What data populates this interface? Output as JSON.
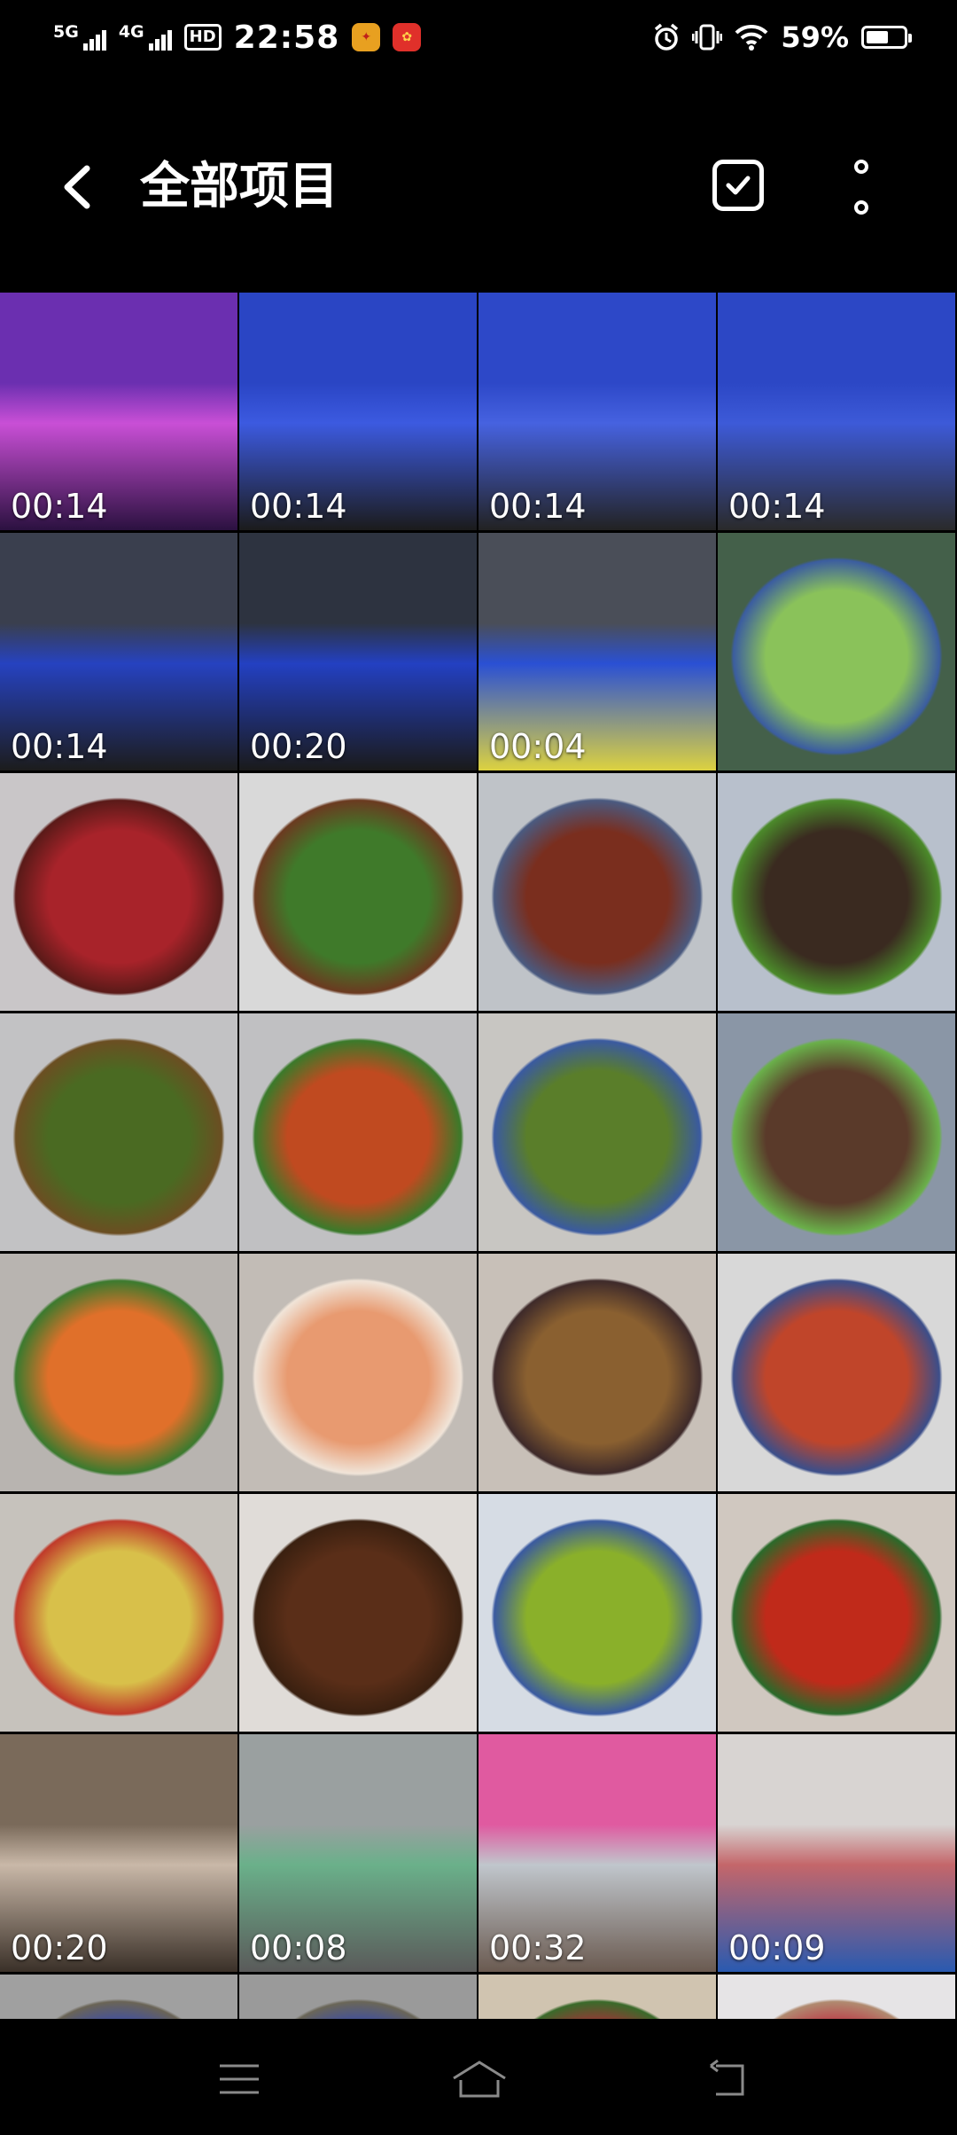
{
  "status_bar": {
    "sig1_label": "5G",
    "sig2_label": "4G",
    "hd_label": "HD",
    "time": "22:58",
    "battery_percent": "59%",
    "battery_level": 0.59
  },
  "header": {
    "title": "全部项目"
  },
  "grid": {
    "columns": 4,
    "items": [
      {
        "duration": "00:14",
        "colors": [
          "#6b2fb0",
          "#c94fd6",
          "#2b1140"
        ]
      },
      {
        "duration": "00:14",
        "colors": [
          "#2a45c4",
          "#3c5ae0",
          "#1b1b1b"
        ]
      },
      {
        "duration": "00:14",
        "colors": [
          "#2d48c8",
          "#4662e0",
          "#222222"
        ]
      },
      {
        "duration": "00:14",
        "colors": [
          "#2c47c5",
          "#3d5ad8",
          "#2a2a2a"
        ]
      },
      {
        "duration": "00:14",
        "colors": [
          "#3a3f4e",
          "#2642c0",
          "#1c1c1c"
        ]
      },
      {
        "duration": "00:20",
        "colors": [
          "#2d3340",
          "#2340c2",
          "#1a1a1a"
        ]
      },
      {
        "duration": "00:04",
        "colors": [
          "#4a4e58",
          "#2a50d4",
          "#dcd240"
        ]
      },
      {
        "duration": "",
        "colors": [
          "#44604a",
          "#8ac25a",
          "#3b5da0"
        ]
      },
      {
        "duration": "",
        "colors": [
          "#c9c6c8",
          "#a8232a",
          "#5a1a18"
        ]
      },
      {
        "duration": "",
        "colors": [
          "#d9d9d9",
          "#3f7a2a",
          "#6b3a20"
        ]
      },
      {
        "duration": "",
        "colors": [
          "#bfc3c8",
          "#7a2e1e",
          "#4a5a80"
        ]
      },
      {
        "duration": "",
        "colors": [
          "#b8c0cc",
          "#3a2a20",
          "#4b8a2a"
        ]
      },
      {
        "duration": "",
        "colors": [
          "#c2c2c4",
          "#4a6a22",
          "#6b4e22"
        ]
      },
      {
        "duration": "",
        "colors": [
          "#c0c0c2",
          "#c04a20",
          "#3a7a2a"
        ]
      },
      {
        "duration": "",
        "colors": [
          "#c8c6c2",
          "#5a7e2a",
          "#3a5aa0"
        ]
      },
      {
        "duration": "",
        "colors": [
          "#8a96a6",
          "#5a3a2a",
          "#6ab04a"
        ]
      },
      {
        "duration": "",
        "colors": [
          "#b8b4b0",
          "#e0702a",
          "#3b7a2e"
        ]
      },
      {
        "duration": "",
        "colors": [
          "#c2bcb6",
          "#e89a70",
          "#f0e4d8"
        ]
      },
      {
        "duration": "",
        "colors": [
          "#c8c0b8",
          "#8a6030",
          "#3e2a2a"
        ]
      },
      {
        "duration": "",
        "colors": [
          "#d8d8d8",
          "#c0452a",
          "#3b4e8a"
        ]
      },
      {
        "duration": "",
        "colors": [
          "#c6c2bc",
          "#d8c04a",
          "#c03a2a"
        ]
      },
      {
        "duration": "",
        "colors": [
          "#e0dcd8",
          "#5a2e18",
          "#3a2010"
        ]
      },
      {
        "duration": "",
        "colors": [
          "#d6dce4",
          "#8ab02a",
          "#3a5aa0"
        ]
      },
      {
        "duration": "",
        "colors": [
          "#d0c8c0",
          "#c02a1a",
          "#2a6a2a"
        ]
      },
      {
        "duration": "00:20",
        "colors": [
          "#7a6a5a",
          "#c9b8a8",
          "#3a3028"
        ]
      },
      {
        "duration": "00:08",
        "colors": [
          "#9aa0a0",
          "#6ab08a",
          "#5a5a5a"
        ]
      },
      {
        "duration": "00:32",
        "colors": [
          "#e05aa0",
          "#c0c6cc",
          "#6a5a50"
        ]
      },
      {
        "duration": "00:09",
        "colors": [
          "#d8d4d2",
          "#c4666a",
          "#2a5ab0"
        ]
      },
      {
        "duration": "",
        "colors": [
          "#a0a0a0",
          "#3048c0",
          "#6a6456"
        ]
      },
      {
        "duration": "",
        "colors": [
          "#9a9a9a",
          "#2e46bc",
          "#6a6658"
        ]
      },
      {
        "duration": "",
        "colors": [
          "#d0c4b0",
          "#c0203a",
          "#3a6a2a"
        ]
      },
      {
        "duration": "",
        "colors": [
          "#e6e4e6",
          "#c0203a",
          "#b08a70"
        ]
      }
    ]
  }
}
